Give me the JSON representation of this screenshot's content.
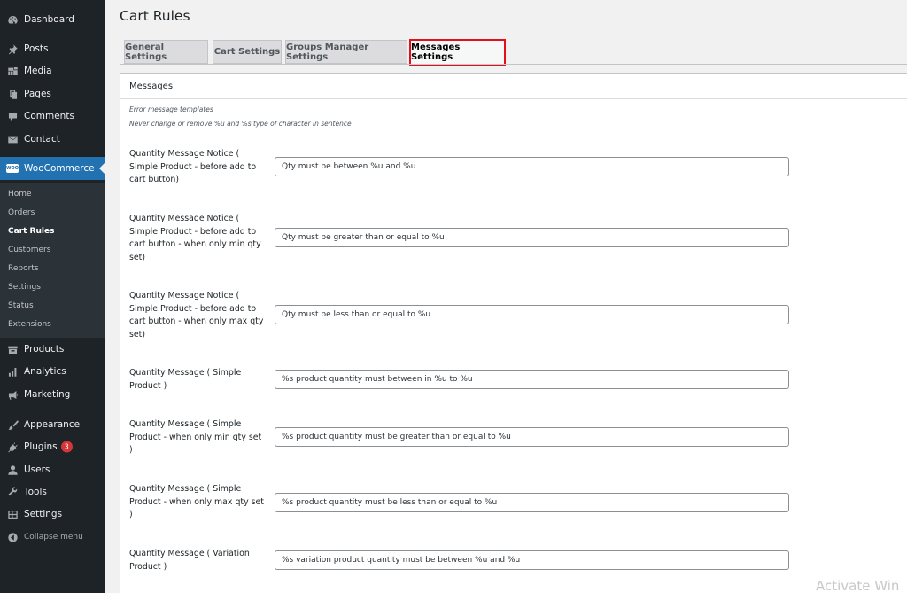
{
  "sidebar": {
    "menu": [
      {
        "label": "Dashboard",
        "icon": "dashboard-icon"
      },
      {
        "label": "Posts",
        "icon": "pin-icon"
      },
      {
        "label": "Media",
        "icon": "media-icon"
      },
      {
        "label": "Pages",
        "icon": "pages-icon"
      },
      {
        "label": "Comments",
        "icon": "comment-icon"
      },
      {
        "label": "Contact",
        "icon": "mail-icon"
      },
      {
        "label": "WooCommerce",
        "icon": "woocommerce-icon"
      },
      {
        "label": "Products",
        "icon": "archive-icon"
      },
      {
        "label": "Analytics",
        "icon": "bar-chart-icon"
      },
      {
        "label": "Marketing",
        "icon": "megaphone-icon"
      },
      {
        "label": "Appearance",
        "icon": "brush-icon"
      },
      {
        "label": "Plugins",
        "icon": "plug-icon",
        "badge": "3"
      },
      {
        "label": "Users",
        "icon": "user-icon"
      },
      {
        "label": "Tools",
        "icon": "wrench-icon"
      },
      {
        "label": "Settings",
        "icon": "settings-icon"
      }
    ],
    "woo_logo_text": "WOO",
    "submenu": [
      "Home",
      "Orders",
      "Cart Rules",
      "Customers",
      "Reports",
      "Settings",
      "Status",
      "Extensions"
    ],
    "collapse_label": "Collapse menu",
    "accent": "#2271b1"
  },
  "page": {
    "title": "Cart Rules",
    "tabs": [
      "General Settings",
      "Cart Settings",
      "Groups Manager Settings",
      "Messages Settings"
    ],
    "active_tab": "Messages Settings",
    "highlight_color": "#e20f1c"
  },
  "panel": {
    "title": "Messages",
    "note1": "Error message templates",
    "note2": "Never change or remove %u and %s type of character in sentence",
    "rows": [
      {
        "label": "Quantity Message Notice ( Simple Product - before add to cart button)",
        "value": "Qty must be between %u and %u"
      },
      {
        "label": "Quantity Message Notice ( Simple Product - before add to cart button - when only min qty set)",
        "value": "Qty must be greater than or equal to %u"
      },
      {
        "label": "Quantity Message Notice ( Simple Product - before add to cart button - when only max qty set)",
        "value": "Qty must be less than or equal to %u"
      },
      {
        "label": "Quantity Message ( Simple Product )",
        "value": "%s product quantity must between in %u to %u"
      },
      {
        "label": "Quantity Message ( Simple Product - when only min qty set )",
        "value": "%s product quantity must be greater than or equal to %u"
      },
      {
        "label": "Quantity Message ( Simple Product - when only max qty set )",
        "value": "%s product quantity must be less than or equal to %u"
      },
      {
        "label": "Quantity Message ( Variation Product )",
        "value": "%s variation product quantity must be between %u and %u"
      }
    ]
  },
  "watermark": "Activate Win"
}
